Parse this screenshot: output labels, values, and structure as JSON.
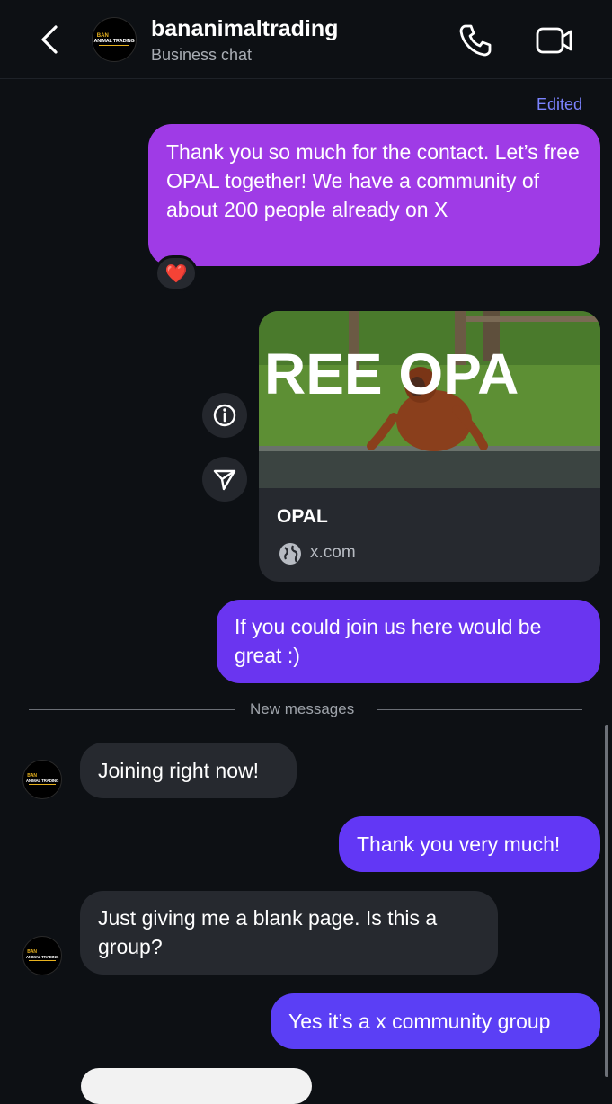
{
  "header": {
    "name": "bananimaltrading",
    "subtitle": "Business chat",
    "avatar_logo": {
      "top": "BAN",
      "middle": "ANIMAL TRADING"
    }
  },
  "edited_label": "Edited",
  "messages": {
    "m1": {
      "text": "Thank you so much for the contact. Let’s free OPAL together! We have a community of about 200 people already on X",
      "reaction": "❤️"
    },
    "link": {
      "image_text": "REE OPA",
      "title": "OPAL",
      "domain": "x.com"
    },
    "m2": {
      "text": "If you could join us here would be great :)"
    },
    "divider": "New messages",
    "m3": {
      "text": "Joining right now!"
    },
    "m4": {
      "text": "Thank you very much!"
    },
    "m5": {
      "text": "Just giving me a blank page. Is this a group?"
    },
    "m6": {
      "text": "Yes it’s a x community group"
    }
  },
  "colors": {
    "background": "#0d1014",
    "outgoing_1": "#9f3be6",
    "outgoing_2": "#6a35f0",
    "outgoing_3": "#6237f5",
    "outgoing_4": "#5b3ff5",
    "incoming": "#26292f",
    "accent_edited": "#7b83ff"
  },
  "icons": [
    "chevron-left-icon",
    "phone-icon",
    "video-camera-icon",
    "info-icon",
    "send-icon",
    "globe-icon",
    "heart-reaction-icon"
  ]
}
